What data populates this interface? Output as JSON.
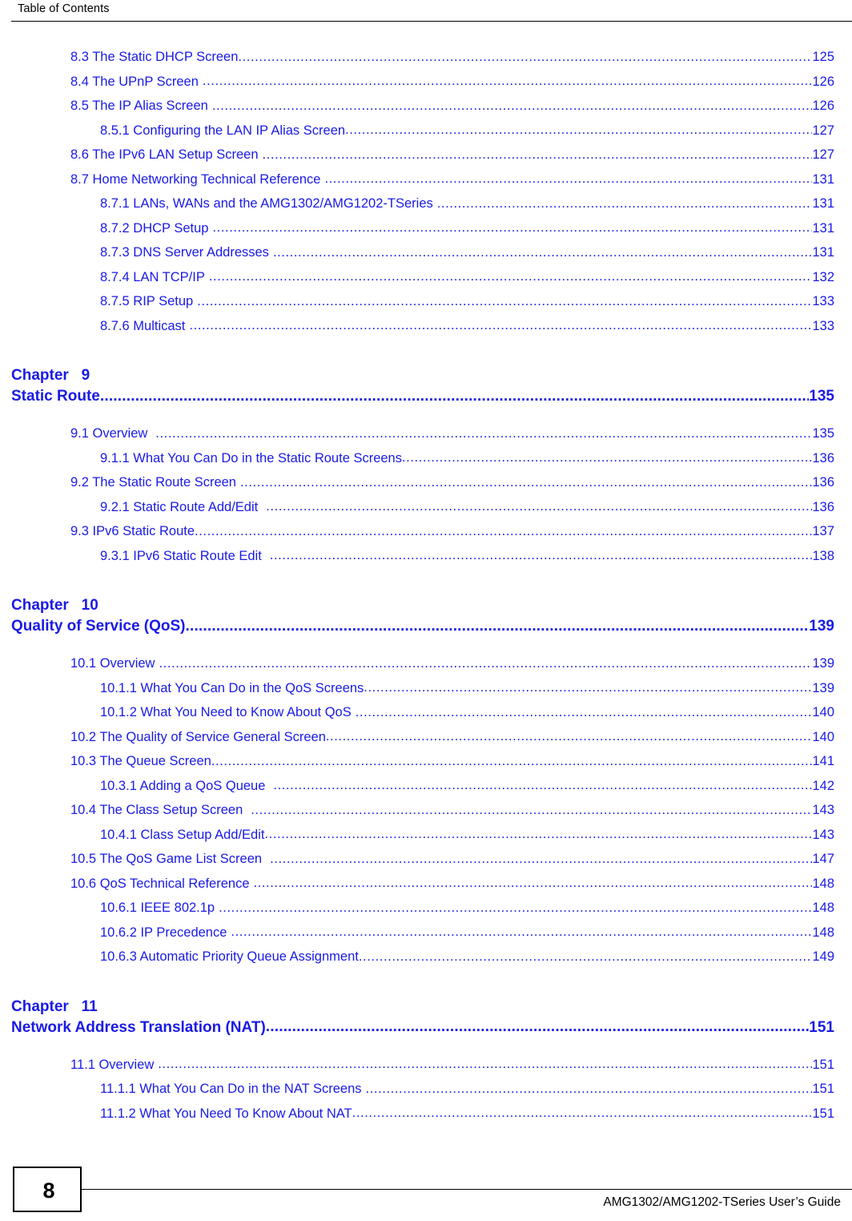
{
  "header": {
    "title": "Table of Contents"
  },
  "footer": {
    "page_number": "8",
    "guide_title": "AMG1302/AMG1202-TSeries User’s Guide"
  },
  "colors": {
    "link_blue": "#1a1ae6",
    "text_black": "#000000",
    "page_background": "#ffffff"
  },
  "toc": {
    "groups": [
      {
        "entries": [
          {
            "level": 1,
            "label": "8.3 The Static DHCP Screen",
            "page": "125",
            "gap": 0
          },
          {
            "level": 1,
            "label": "8.4 The UPnP Screen",
            "page": "126",
            "gap": 1
          },
          {
            "level": 1,
            "label": "8.5 The IP Alias Screen",
            "page": "126",
            "gap": 1
          },
          {
            "level": 2,
            "label": "8.5.1 Configuring the LAN IP Alias Screen",
            "page": "127",
            "gap": 0
          },
          {
            "level": 1,
            "label": "8.6 The IPv6 LAN Setup Screen",
            "page": "127",
            "gap": 1
          },
          {
            "level": 1,
            "label": "8.7 Home Networking Technical Reference",
            "page": "131",
            "gap": 1
          },
          {
            "level": 2,
            "label": "8.7.1 LANs, WANs and the AMG1302/AMG1202-TSeries",
            "page": "131",
            "gap": 1
          },
          {
            "level": 2,
            "label": "8.7.2 DHCP Setup",
            "page": "131",
            "gap": 1
          },
          {
            "level": 2,
            "label": "8.7.3 DNS Server Addresses",
            "page": "131",
            "gap": 1
          },
          {
            "level": 2,
            "label": "8.7.4 LAN TCP/IP",
            "page": "132",
            "gap": 1
          },
          {
            "level": 2,
            "label": "8.7.5 RIP Setup",
            "page": "133",
            "gap": 1
          },
          {
            "level": 2,
            "label": "8.7.6 Multicast",
            "page": "133",
            "gap": 1
          }
        ]
      },
      {
        "chapter_label": "Chapter   9",
        "chapter_title": "Static Route",
        "chapter_page": "135",
        "entries": [
          {
            "level": 1,
            "label": "9.1 Overview",
            "page": "135",
            "gap": 2
          },
          {
            "level": 2,
            "label": "9.1.1 What You Can Do in the Static Route Screens",
            "page": "136",
            "gap": 0
          },
          {
            "level": 1,
            "label": "9.2 The Static Route Screen",
            "page": "136",
            "gap": 1
          },
          {
            "level": 2,
            "label": "9.2.1 Static Route Add/Edit",
            "page": "136",
            "gap": 2
          },
          {
            "level": 1,
            "label": "9.3 IPv6 Static Route",
            "page": "137",
            "gap": 0
          },
          {
            "level": 2,
            "label": "9.3.1 IPv6 Static Route Edit",
            "page": "138",
            "gap": 2
          }
        ]
      },
      {
        "chapter_label": "Chapter   10",
        "chapter_title": "Quality of Service (QoS)",
        "chapter_page": "139",
        "entries": [
          {
            "level": 1,
            "label": "10.1 Overview",
            "page": "139",
            "gap": 1
          },
          {
            "level": 2,
            "label": "10.1.1 What You Can Do in the QoS Screens",
            "page": "139",
            "gap": 0
          },
          {
            "level": 2,
            "label": "10.1.2 What You Need to Know About QoS",
            "page": "140",
            "gap": 1
          },
          {
            "level": 1,
            "label": "10.2 The Quality of Service General Screen",
            "page": "140",
            "gap": 0
          },
          {
            "level": 1,
            "label": "10.3 The Queue Screen",
            "page": "141",
            "gap": 0
          },
          {
            "level": 2,
            "label": "10.3.1 Adding a QoS Queue",
            "page": "142",
            "gap": 2
          },
          {
            "level": 1,
            "label": "10.4 The Class Setup Screen",
            "page": "143",
            "gap": 2
          },
          {
            "level": 2,
            "label": "10.4.1 Class Setup Add/Edit",
            "page": "143",
            "gap": 0
          },
          {
            "level": 1,
            "label": "10.5 The QoS Game List Screen",
            "page": "147",
            "gap": 2
          },
          {
            "level": 1,
            "label": "10.6 QoS Technical Reference",
            "page": "148",
            "gap": 1
          },
          {
            "level": 2,
            "label": "10.6.1 IEEE 802.1p",
            "page": "148",
            "gap": 1
          },
          {
            "level": 2,
            "label": "10.6.2 IP Precedence",
            "page": "148",
            "gap": 1
          },
          {
            "level": 2,
            "label": "10.6.3 Automatic Priority Queue Assignment",
            "page": "149",
            "gap": 0
          }
        ]
      },
      {
        "chapter_label": "Chapter   11",
        "chapter_title": "Network Address Translation (NAT)",
        "chapter_page": "151",
        "entries": [
          {
            "level": 1,
            "label": "11.1 Overview",
            "page": "151",
            "gap": 1
          },
          {
            "level": 2,
            "label": "11.1.1 What You Can Do in the NAT Screens",
            "page": "151",
            "gap": 1
          },
          {
            "level": 2,
            "label": "11.1.2 What You Need To Know About NAT",
            "page": "151",
            "gap": 0
          }
        ]
      }
    ]
  }
}
